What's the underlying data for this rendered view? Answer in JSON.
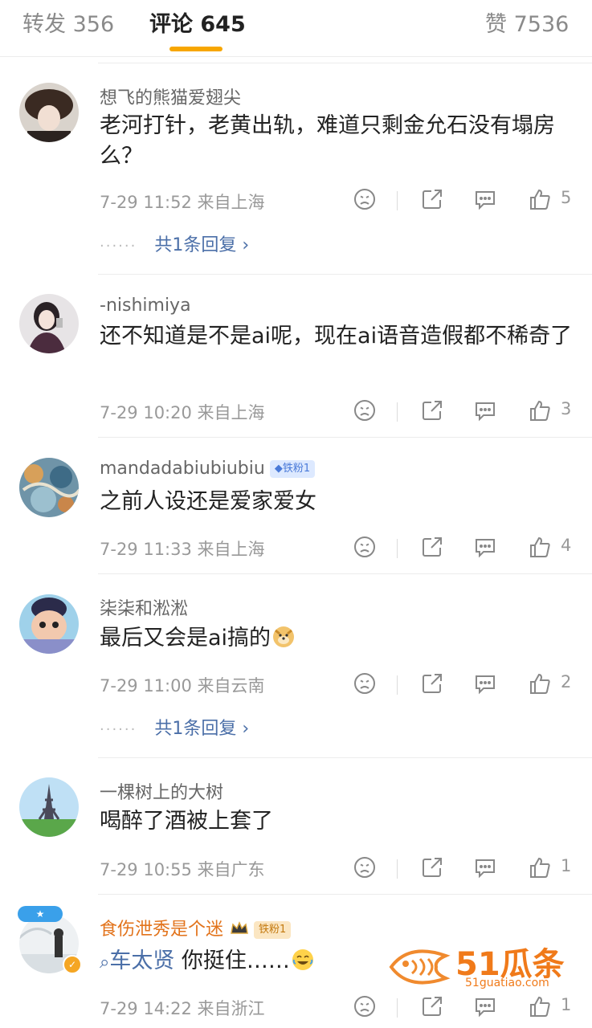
{
  "tabs": {
    "repost": "转发 356",
    "comments": "评论 645",
    "likes": "赞 7536"
  },
  "comments": [
    {
      "user": "想飞的熊猫爱翅尖",
      "text": "老河打针，老黄出轨，难道只剩金允石没有塌房么？",
      "time": "7-29 11:52",
      "location": "来自上海",
      "likes": "5",
      "replies": "共1条回复"
    },
    {
      "user": "-nishimiya",
      "text": "还不知道是不是ai呢，现在ai语音造假都不稀奇了",
      "time": "7-29 10:20",
      "location": "来自上海",
      "likes": "3"
    },
    {
      "user": "mandadabiubiubiu",
      "badge": "铁粉1",
      "text": "之前人设还是爱家爱女",
      "time": "7-29 11:33",
      "location": "来自上海",
      "likes": "4"
    },
    {
      "user": "柒柒和淞淞",
      "text": "最后又会是ai搞的",
      "time": "7-29 11:00",
      "location": "来自云南",
      "likes": "2",
      "replies": "共1条回复"
    },
    {
      "user": "一棵树上的大树",
      "text": "喝醉了酒被上套了",
      "time": "7-29 10:55",
      "location": "来自广东",
      "likes": "1"
    },
    {
      "user": "食伤泄秀是个迷",
      "badge": "铁粉1",
      "mention": "车太贤",
      "text": "你挺住……",
      "time": "7-29 14:22",
      "location": "来自浙江",
      "likes": "1"
    }
  ],
  "watermark": {
    "logo": "51瓜条",
    "url": "51guatiao.com"
  },
  "colors": {
    "accent": "#f7a600",
    "link": "#4b6fa8",
    "gold_name": "#e2731b"
  }
}
